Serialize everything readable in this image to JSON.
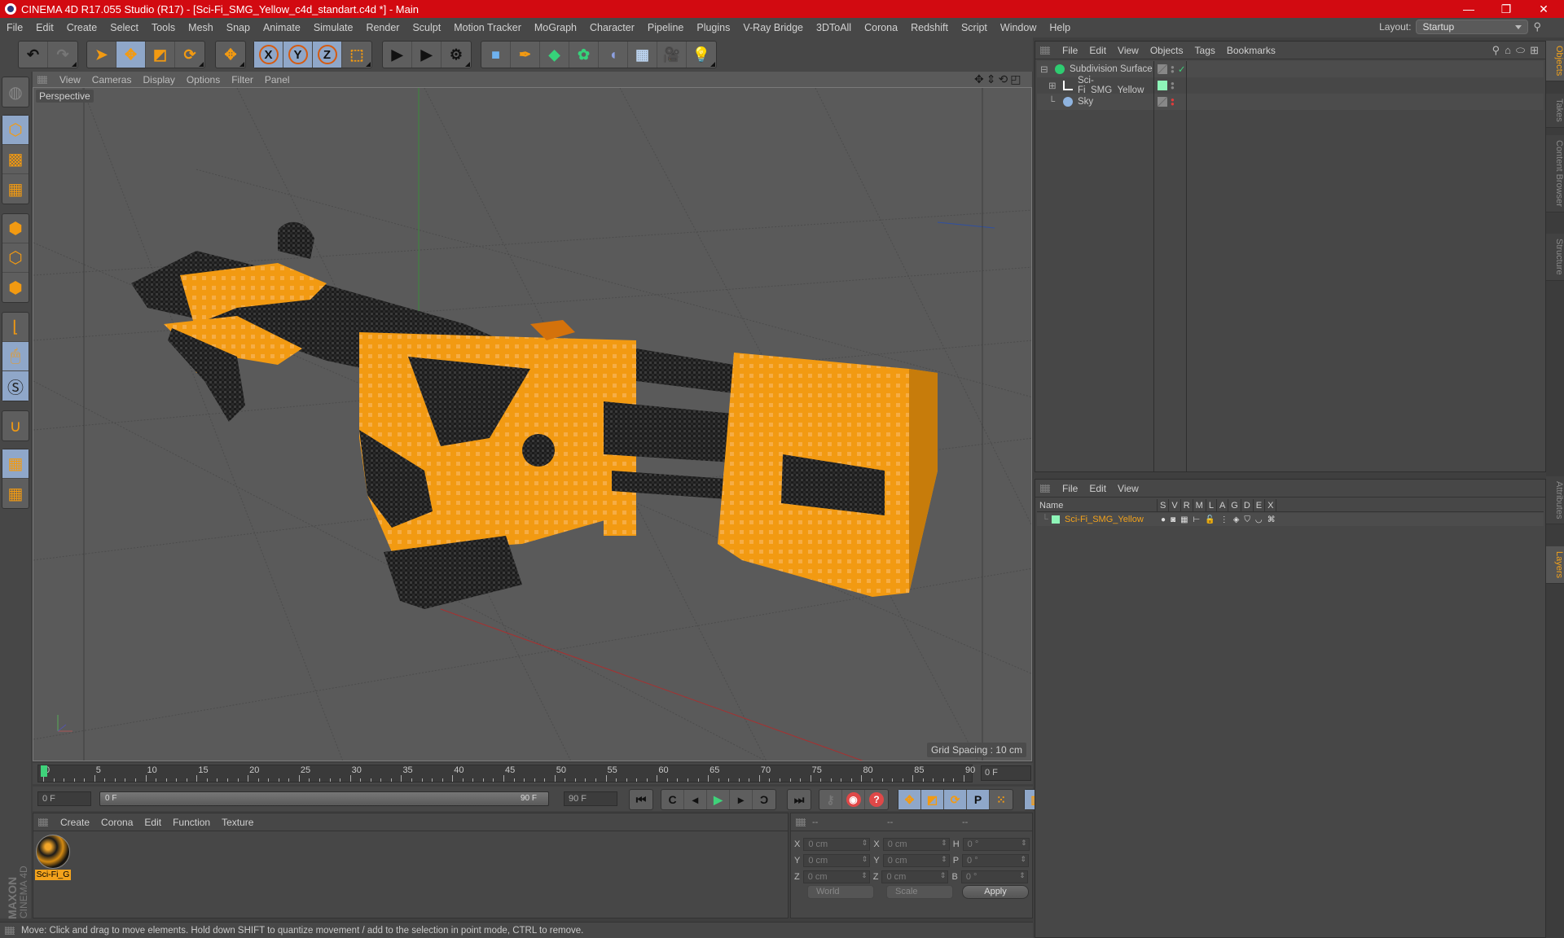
{
  "window": {
    "title": "CINEMA 4D R17.055 Studio (R17) - [Sci-Fi_SMG_Yellow_c4d_standart.c4d *] - Main",
    "controls": {
      "minimize": "—",
      "restore": "❐",
      "close": "✕"
    }
  },
  "menubar": {
    "items": [
      "File",
      "Edit",
      "Create",
      "Select",
      "Tools",
      "Mesh",
      "Snap",
      "Animate",
      "Simulate",
      "Render",
      "Sculpt",
      "Motion Tracker",
      "MoGraph",
      "Character",
      "Pipeline",
      "Plugins",
      "V-Ray Bridge",
      "3DToAll",
      "Corona",
      "Redshift",
      "Script",
      "Window",
      "Help"
    ],
    "layout_label": "Layout:",
    "layout_value": "Startup"
  },
  "toolbar": {
    "groups": [
      {
        "buttons": [
          {
            "icon": "undo-icon",
            "glyph": "↶",
            "active": false
          },
          {
            "icon": "redo-icon",
            "glyph": "↷",
            "active": false
          }
        ]
      },
      {
        "buttons": [
          {
            "icon": "live-selection-icon",
            "glyph": "➤",
            "active": false
          },
          {
            "icon": "move-icon",
            "glyph": "✥",
            "active": true
          },
          {
            "icon": "scale-icon",
            "glyph": "◩",
            "active": false
          },
          {
            "icon": "rotate-icon",
            "glyph": "⟳",
            "active": false
          }
        ]
      },
      {
        "buttons": [
          {
            "icon": "last-tool-move-icon",
            "glyph": "✥",
            "active": false
          }
        ]
      },
      {
        "buttons": [
          {
            "icon": "x-axis-icon",
            "glyph": "X",
            "active": true
          },
          {
            "icon": "y-axis-icon",
            "glyph": "Y",
            "active": true
          },
          {
            "icon": "z-axis-icon",
            "glyph": "Z",
            "active": true
          },
          {
            "icon": "coordinate-system-icon",
            "glyph": "⬚",
            "active": false
          }
        ]
      },
      {
        "buttons": [
          {
            "icon": "render-view-icon",
            "glyph": "▶",
            "active": false
          },
          {
            "icon": "render-picture-viewer-icon",
            "glyph": "▶",
            "active": false
          },
          {
            "icon": "render-settings-icon",
            "glyph": "⚙",
            "active": false
          }
        ]
      },
      {
        "buttons": [
          {
            "icon": "cube-icon",
            "glyph": "■",
            "active": false
          },
          {
            "icon": "pen-spline-icon",
            "glyph": "✒",
            "active": false
          },
          {
            "icon": "subdivision-surface-icon",
            "glyph": "◆",
            "active": false
          },
          {
            "icon": "cloner-icon",
            "glyph": "✿",
            "active": false
          },
          {
            "icon": "bend-deformer-icon",
            "glyph": "◖",
            "active": false
          },
          {
            "icon": "floor-icon",
            "glyph": "▦",
            "active": false
          },
          {
            "icon": "camera-icon",
            "glyph": "🎥",
            "active": false
          },
          {
            "icon": "light-icon",
            "glyph": "💡",
            "active": false
          }
        ]
      }
    ]
  },
  "left_toolbar": {
    "groups": [
      {
        "buttons": [
          {
            "icon": "make-editable-icon",
            "active": false
          }
        ]
      },
      {
        "buttons": [
          {
            "icon": "model-mode-icon",
            "active": true
          },
          {
            "icon": "texture-mode-icon",
            "active": false
          },
          {
            "icon": "workplane-mode-icon",
            "active": false
          }
        ]
      },
      {
        "buttons": [
          {
            "icon": "points-mode-icon",
            "active": false
          },
          {
            "icon": "edges-mode-icon",
            "active": false
          },
          {
            "icon": "polygons-mode-icon",
            "active": false
          }
        ]
      },
      {
        "buttons": [
          {
            "icon": "axis-mode-icon",
            "active": false
          },
          {
            "icon": "tweak-mode-icon",
            "active": true
          },
          {
            "icon": "snap-solo-icon",
            "active": true
          }
        ]
      },
      {
        "buttons": [
          {
            "icon": "magnet-snap-icon",
            "active": false
          }
        ]
      },
      {
        "buttons": [
          {
            "icon": "lock-workplane-icon",
            "active": true
          },
          {
            "icon": "align-workplane-icon",
            "active": false
          }
        ]
      }
    ]
  },
  "viewport": {
    "menu": [
      "View",
      "Cameras",
      "Display",
      "Options",
      "Filter",
      "Panel"
    ],
    "camera_label": "Perspective",
    "grid_spacing": "Grid Spacing : 10 cm",
    "nav_icons": [
      "move-view-icon",
      "zoom-view-icon",
      "rotate-view-icon",
      "maximize-view-icon"
    ],
    "colors": {
      "model_orange": "#f29a12",
      "model_dark": "#1e1e1e",
      "bg": "#5a5a5a",
      "grid": "#4d4d4d"
    }
  },
  "timeline": {
    "ticks": [
      "0",
      "5",
      "10",
      "15",
      "20",
      "25",
      "30",
      "35",
      "40",
      "45",
      "50",
      "55",
      "60",
      "65",
      "70",
      "75",
      "80",
      "85",
      "90"
    ],
    "current_frame_field": "0 F",
    "start_field": "0 F",
    "range_start": "0 F",
    "range_end": "90 F",
    "end_field": "90 F",
    "max_frame": 90,
    "current_frame": 0
  },
  "transport": {
    "groups": [
      [
        {
          "icon": "go-to-start-icon",
          "glyph": "⏮"
        }
      ],
      [
        {
          "icon": "previous-key-icon",
          "glyph": "C"
        },
        {
          "icon": "previous-frame-icon",
          "glyph": "◂"
        },
        {
          "icon": "play-icon",
          "glyph": "▶"
        },
        {
          "icon": "next-frame-icon",
          "glyph": "▸"
        },
        {
          "icon": "next-key-icon",
          "glyph": "Ɔ"
        }
      ],
      [
        {
          "icon": "go-to-end-icon",
          "glyph": "⏭"
        }
      ],
      [
        {
          "icon": "record-keys-icon",
          "glyph": "⚷"
        },
        {
          "icon": "autokey-icon",
          "glyph": "◉"
        },
        {
          "icon": "keyframe-selection-icon",
          "glyph": "?"
        }
      ],
      [
        {
          "icon": "key-position-icon",
          "glyph": "✥",
          "active": true
        },
        {
          "icon": "key-scale-icon",
          "glyph": "◩",
          "active": true
        },
        {
          "icon": "key-rotation-icon",
          "glyph": "⟳",
          "active": true
        },
        {
          "icon": "key-parameter-icon",
          "glyph": "P",
          "active": true
        },
        {
          "icon": "key-pla-icon",
          "glyph": "⁙",
          "active": false
        }
      ],
      [
        {
          "icon": "timeline-window-icon",
          "glyph": "▥",
          "active": true
        }
      ]
    ]
  },
  "material_manager": {
    "menu": [
      "Create",
      "Corona",
      "Edit",
      "Function",
      "Texture"
    ],
    "materials": [
      {
        "name": "Sci-Fi_G"
      }
    ]
  },
  "coordinates": {
    "headers": [
      "--",
      "--",
      "--"
    ],
    "rows": [
      {
        "a": "X",
        "av": "0 cm",
        "b": "X",
        "bv": "0 cm",
        "c": "H",
        "cv": "0 °"
      },
      {
        "a": "Y",
        "av": "0 cm",
        "b": "Y",
        "bv": "0 cm",
        "c": "P",
        "cv": "0 °"
      },
      {
        "a": "Z",
        "av": "0 cm",
        "b": "Z",
        "bv": "0 cm",
        "c": "B",
        "cv": "0 °"
      }
    ],
    "mode_select": "World",
    "size_select": "Scale",
    "apply_label": "Apply"
  },
  "status_bar": {
    "text": "Move: Click and drag to move elements. Hold down SHIFT to quantize movement / add to the selection in point mode, CTRL to remove."
  },
  "branding": {
    "maxon": "MAXON",
    "product": "CINEMA 4D"
  },
  "object_manager": {
    "menu": [
      "File",
      "Edit",
      "View",
      "Objects",
      "Tags",
      "Bookmarks"
    ],
    "objects": [
      {
        "name": "Subdivision Surface",
        "icon": "subdivision-surface-icon",
        "expander": "⊟",
        "tag": "check",
        "color": "#2ecc71"
      },
      {
        "name": "Sci-Fi_SMG_Yellow",
        "icon": "null-object-icon",
        "expander": "⊞",
        "tag": "layer",
        "color": "#8ef5b8"
      },
      {
        "name": "Sky",
        "icon": "sky-icon",
        "expander": "",
        "tag": "red-dot",
        "color": "#8fb4e0"
      }
    ]
  },
  "layer_manager": {
    "menu": [
      "File",
      "Edit",
      "View"
    ],
    "columns": [
      "Name",
      "S",
      "V",
      "R",
      "M",
      "L",
      "A",
      "G",
      "D",
      "E",
      "X"
    ],
    "layers": [
      {
        "name": "Sci-Fi_SMG_Yellow",
        "color": "#8ef5b8"
      }
    ]
  },
  "side_tabs": {
    "top": [
      {
        "label": "Objects",
        "active": true
      },
      {
        "label": "Takes",
        "active": false
      },
      {
        "label": "Content Browser",
        "active": false
      },
      {
        "label": "Structure",
        "active": false
      }
    ],
    "bottom": [
      {
        "label": "Attributes",
        "active": false
      },
      {
        "label": "Layers",
        "active": true
      }
    ]
  }
}
